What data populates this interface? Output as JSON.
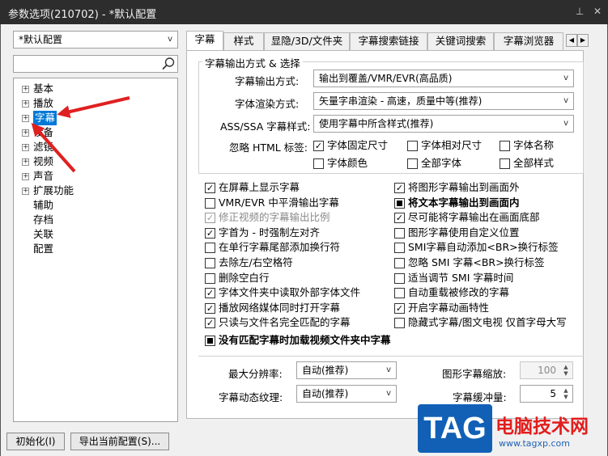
{
  "window": {
    "title": "参数选项(210702) - *默认配置"
  },
  "sidebar": {
    "profile_combo": "*默认配置",
    "search_placeholder": "",
    "tree": [
      {
        "label": "基本",
        "expandable": true
      },
      {
        "label": "播放",
        "expandable": true
      },
      {
        "label": "字幕",
        "expandable": true,
        "selected": true
      },
      {
        "label": "设备",
        "expandable": true
      },
      {
        "label": "滤镜",
        "expandable": true
      },
      {
        "label": "视频",
        "expandable": true
      },
      {
        "label": "声音",
        "expandable": true
      },
      {
        "label": "扩展功能",
        "expandable": true
      },
      {
        "label": "辅助",
        "expandable": false
      },
      {
        "label": "存档",
        "expandable": false
      },
      {
        "label": "关联",
        "expandable": false
      },
      {
        "label": "配置",
        "expandable": false
      }
    ]
  },
  "footer": {
    "init_button": "初始化(I)",
    "export_button": "导出当前配置(S)..."
  },
  "tabs": [
    "字幕",
    "样式",
    "显隐/3D/文件夹",
    "字幕搜索链接",
    "关键词搜索",
    "字幕浏览器"
  ],
  "group": {
    "title": "字幕输出方式 & 选择",
    "output_mode_label": "字幕输出方式:",
    "output_mode_value": "输出到覆盖/VMR/EVR(高品质)",
    "font_render_label": "字体渲染方式:",
    "font_render_value": "矢量字串渲染 - 高速，质量中等(推荐)",
    "ass_style_label": "ASS/SSA 字幕样式:",
    "ass_style_value": "使用字幕中所含样式(推荐)",
    "ignore_html_label": "忽略 HTML 标签:",
    "html_options": [
      {
        "label": "字体固定尺寸",
        "checked": true
      },
      {
        "label": "字体相对尺寸",
        "checked": false
      },
      {
        "label": "字体名称",
        "checked": false
      },
      {
        "label": "字体颜色",
        "checked": false
      },
      {
        "label": "全部字体",
        "checked": false
      },
      {
        "label": "全部样式",
        "checked": false
      }
    ]
  },
  "options_left": [
    {
      "label": "在屏幕上显示字幕",
      "state": "checked"
    },
    {
      "label": "VMR/EVR 中平滑输出字幕",
      "state": "unchecked"
    },
    {
      "label": "修正视频的字幕输出比例",
      "state": "disabled-checked"
    },
    {
      "label": "字首为 - 时强制左对齐",
      "state": "checked"
    },
    {
      "label": "在单行字幕尾部添加换行符",
      "state": "unchecked"
    },
    {
      "label": "去除左/右空格符",
      "state": "unchecked"
    },
    {
      "label": "删除空白行",
      "state": "unchecked"
    },
    {
      "label": "字体文件夹中读取外部字体文件",
      "state": "checked"
    },
    {
      "label": "播放网络媒体同时打开字幕",
      "state": "checked"
    },
    {
      "label": "只读与文件名完全匹配的字幕",
      "state": "checked"
    }
  ],
  "options_right": [
    {
      "label": "将图形字幕输出到画面外",
      "state": "checked"
    },
    {
      "label": "将文本字幕输出到画面内",
      "state": "indeterminate"
    },
    {
      "label": "尽可能将字幕输出在画面底部",
      "state": "checked"
    },
    {
      "label": "图形字幕使用自定义位置",
      "state": "unchecked"
    },
    {
      "label": "SMI字幕自动添加<BR>换行标签",
      "state": "unchecked"
    },
    {
      "label": "忽略 SMI 字幕<BR>换行标签",
      "state": "unchecked"
    },
    {
      "label": "适当调节 SMI 字幕时间",
      "state": "unchecked"
    },
    {
      "label": "自动重载被修改的字幕",
      "state": "unchecked"
    },
    {
      "label": "开启字幕动画特性",
      "state": "checked"
    },
    {
      "label": "隐藏式字幕/图文电视 仅首字母大写",
      "state": "unchecked"
    }
  ],
  "option_full": {
    "label": "没有匹配字幕时加载视频文件夹中字幕",
    "state": "indeterminate"
  },
  "bottom": {
    "max_res_label": "最大分辨率:",
    "max_res_value": "自动(推荐)",
    "texture_label": "字幕动态纹理:",
    "texture_value": "自动(推荐)",
    "graphic_scale_label": "图形字幕缩放:",
    "graphic_scale_value": "100",
    "buffer_label": "字幕缓冲量:",
    "buffer_value": "5"
  },
  "watermark": {
    "tag": "TAG",
    "title": "电脑技术网",
    "url": "www.tagxp.com"
  },
  "colors": {
    "selection": "#0078d7",
    "annotation_arrow": "#e02020",
    "watermark_blue": "#1160b6",
    "watermark_red": "#e21d1d"
  }
}
